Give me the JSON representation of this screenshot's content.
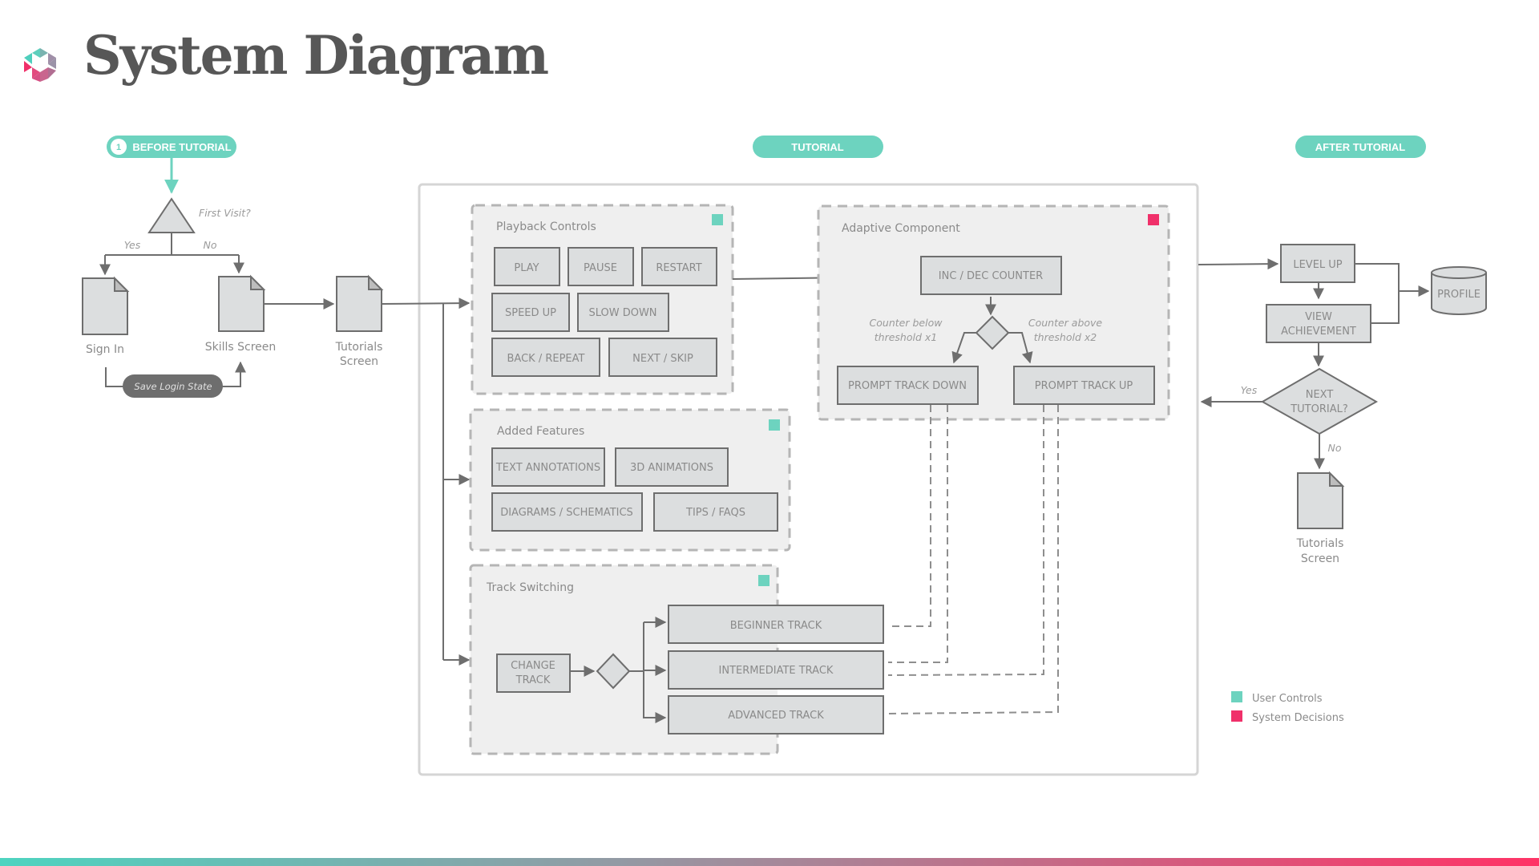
{
  "header": {
    "title": "System Diagram",
    "logo_icon": "hexagon-logo-icon"
  },
  "colors": {
    "accent_teal": "#6dd3bf",
    "accent_pink": "#f0306a",
    "text_gray": "#8a8a8a",
    "title_gray": "#575757",
    "box_fill": "#dcdedf",
    "group_fill": "#efefef",
    "gradient_start": "#4dd4c0",
    "gradient_end": "#ff3366"
  },
  "phases": {
    "before": {
      "number": "1",
      "label": "BEFORE TUTORIAL"
    },
    "tutorial": {
      "label": "TUTORIAL"
    },
    "after": {
      "label": "AFTER TUTORIAL"
    }
  },
  "before_tutorial": {
    "decision": "First Visit?",
    "yes": "Yes",
    "no": "No",
    "sign_in": "Sign In",
    "skills_screen": "Skills Screen",
    "tutorials_screen_line1": "Tutorials",
    "tutorials_screen_line2": "Screen",
    "save_login_state": "Save Login State"
  },
  "playback_controls": {
    "title": "Playback Controls",
    "buttons": [
      "PLAY",
      "PAUSE",
      "RESTART",
      "SPEED UP",
      "SLOW DOWN",
      "BACK / REPEAT",
      "NEXT / SKIP"
    ]
  },
  "added_features": {
    "title": "Added Features",
    "buttons": [
      "TEXT ANNOTATIONS",
      "3D ANIMATIONS",
      "DIAGRAMS / SCHEMATICS",
      "TIPS / FAQS"
    ]
  },
  "track_switching": {
    "title": "Track Switching",
    "change_track_line1": "CHANGE",
    "change_track_line2": "TRACK",
    "tracks": [
      "BEGINNER TRACK",
      "INTERMEDIATE TRACK",
      "ADVANCED TRACK"
    ]
  },
  "adaptive_component": {
    "title": "Adaptive Component",
    "counter": "INC / DEC COUNTER",
    "below_line1": "Counter below",
    "below_line2": "threshold x1",
    "above_line1": "Counter above",
    "above_line2": "threshold x2",
    "prompt_down": "PROMPT TRACK DOWN",
    "prompt_up": "PROMPT TRACK UP"
  },
  "after_tutorial": {
    "level_up": "LEVEL UP",
    "view_achievement_line1": "VIEW",
    "view_achievement_line2": "ACHIEVEMENT",
    "profile": "PROFILE",
    "next_tutorial_line1": "NEXT",
    "next_tutorial_line2": "TUTORIAL?",
    "yes": "Yes",
    "no": "No",
    "tutorials_screen_line1": "Tutorials",
    "tutorials_screen_line2": "Screen"
  },
  "legend": [
    {
      "label": "User Controls",
      "color": "#6dd3bf"
    },
    {
      "label": "System Decisions",
      "color": "#f0306a"
    }
  ]
}
